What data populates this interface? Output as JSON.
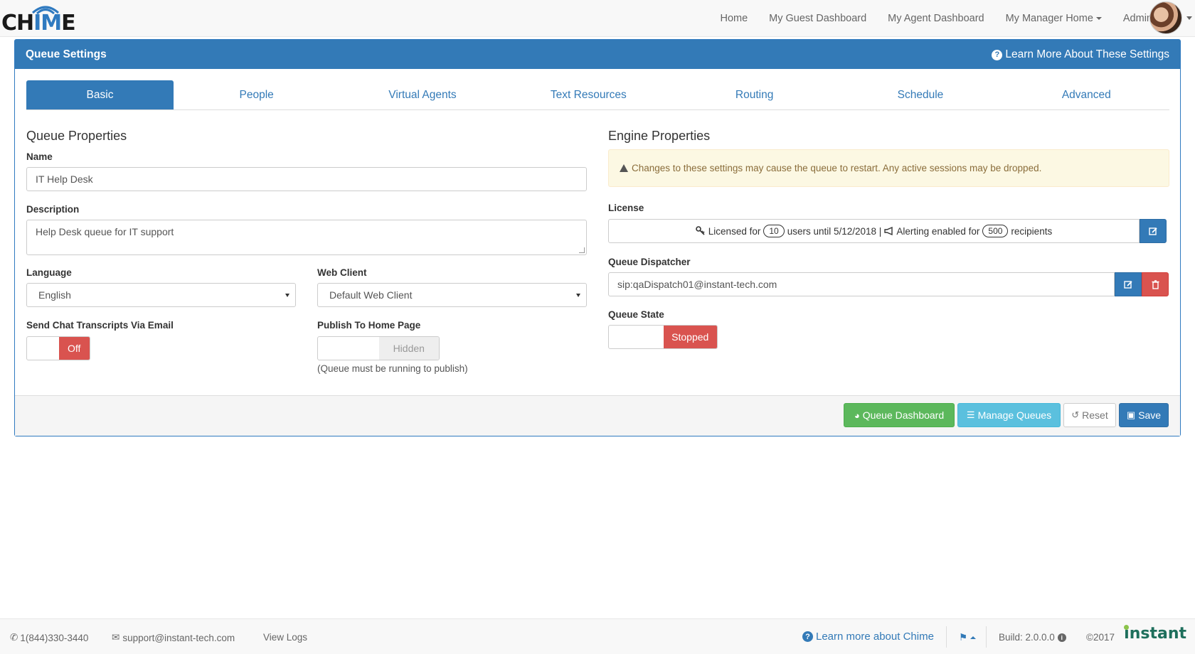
{
  "navbar": {
    "logo_text_left": "CH",
    "logo_text_hl": "IM",
    "logo_text_right": "E",
    "links": [
      "Home",
      "My Guest Dashboard",
      "My Agent Dashboard",
      "My Manager Home",
      "Admin"
    ]
  },
  "panel": {
    "title": "Queue Settings",
    "learn_more": "Learn More About These Settings",
    "tabs": [
      "Basic",
      "People",
      "Virtual Agents",
      "Text Resources",
      "Routing",
      "Schedule",
      "Advanced"
    ]
  },
  "queue_properties": {
    "title": "Queue Properties",
    "name_label": "Name",
    "name_value": "IT Help Desk",
    "description_label": "Description",
    "description_value": "Help Desk queue for IT support",
    "language_label": "Language",
    "language_value": "English",
    "web_client_label": "Web Client",
    "web_client_value": "Default Web Client",
    "transcripts_label": "Send Chat Transcripts Via Email",
    "transcripts_state": "Off",
    "publish_label": "Publish To Home Page",
    "publish_state": "Hidden",
    "publish_help": "(Queue must be running to publish)"
  },
  "engine_properties": {
    "title": "Engine Properties",
    "warning": "Changes to these settings may cause the queue to restart. Any active sessions may be dropped.",
    "license_label": "License",
    "license_prefix": "Licensed for",
    "license_users": "10",
    "license_middle": "users until 5/12/2018 |",
    "alerting_prefix": "Alerting enabled for",
    "alerting_count": "500",
    "alerting_suffix": "recipients",
    "dispatcher_label": "Queue Dispatcher",
    "dispatcher_value": "sip:qaDispatch01@instant-tech.com",
    "state_label": "Queue State",
    "state_value": "Stopped"
  },
  "actions": {
    "dashboard": "Queue Dashboard",
    "manage": "Manage Queues",
    "reset": "Reset",
    "save": "Save"
  },
  "footer": {
    "phone": "1(844)330-3440",
    "email": "support@instant-tech.com",
    "view_logs": "View Logs",
    "learn_chime": "Learn more about Chime",
    "build": "Build: 2.0.0.0",
    "copyright": "©2017",
    "brand": "instant"
  },
  "colors": {
    "primary": "#337ab7",
    "danger": "#d9534f",
    "success": "#5cb85c",
    "info": "#5bc0de",
    "warning_bg": "#fcf8e3"
  }
}
